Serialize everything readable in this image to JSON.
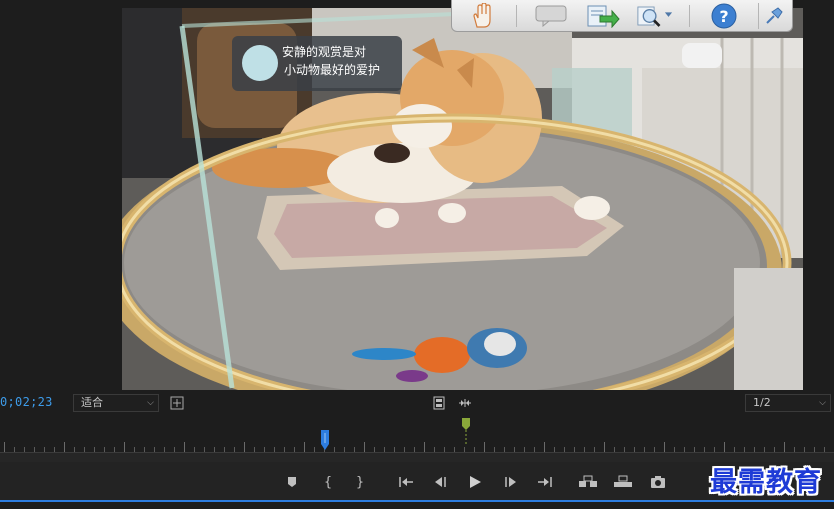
{
  "monitor": {
    "frame_sign_text_line1": "安静的观赏是对",
    "frame_sign_text_line2": "小动物最好的爱护"
  },
  "floating_toolbar": {
    "icons": [
      "hand-icon",
      "comment-icon",
      "export-arrow-icon",
      "zoom-icon",
      "help-icon",
      "pin-icon"
    ]
  },
  "controls": {
    "timecode": "0;02;23",
    "fit_value": "适合",
    "resolution_value": "1/2"
  },
  "transport": {
    "buttons": [
      "add-marker",
      "mark-in",
      "mark-out",
      "go-to-in",
      "step-back",
      "play",
      "step-forward",
      "go-to-out",
      "insert",
      "overwrite",
      "export-frame"
    ]
  },
  "watermark": "最需教育",
  "colors": {
    "accent_blue": "#3d9be9",
    "playhead_blue": "#2d7de0",
    "in_marker_green": "#8aa83a",
    "watermark_blue": "#1e3bd6"
  }
}
